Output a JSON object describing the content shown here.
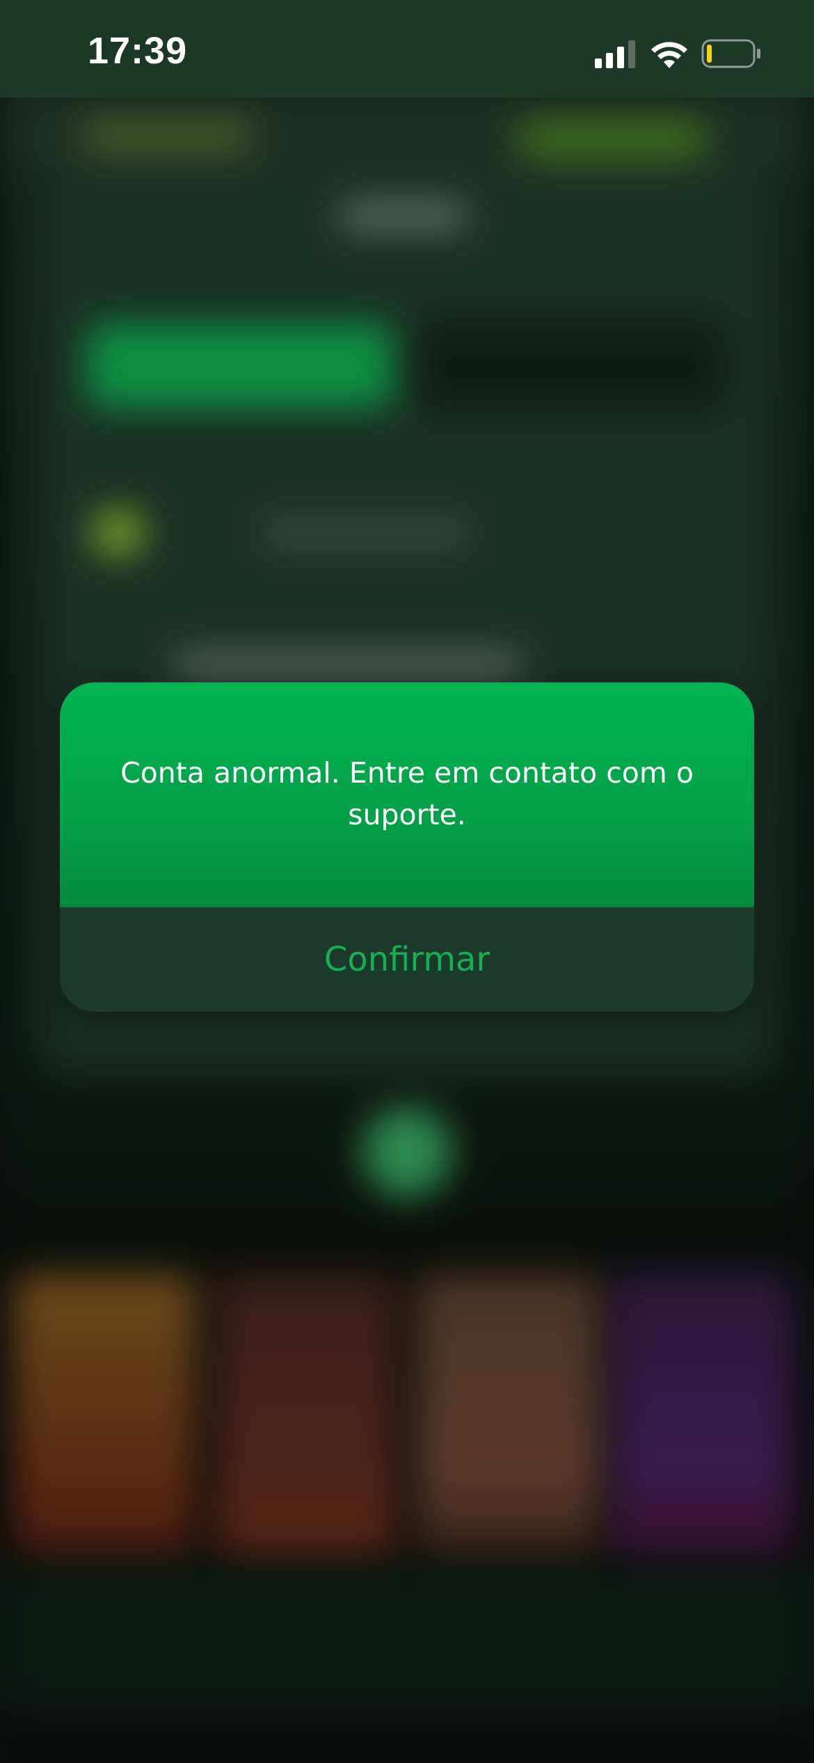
{
  "status_bar": {
    "time": "17:39",
    "signal_icon": "cellular-signal-icon",
    "wifi_icon": "wifi-icon",
    "battery_icon": "battery-low-icon",
    "battery_level": 0.12
  },
  "dialog": {
    "message": "Conta anormal. Entre em contato com o suporte.",
    "confirm_label": "Confirmar"
  },
  "colors": {
    "accent_green": "#03a24a",
    "confirm_text": "#14b052",
    "footer_bg": "#1c3a2b",
    "status_bar_bg": "#1b3828",
    "battery_fill": "#f3d21b"
  }
}
